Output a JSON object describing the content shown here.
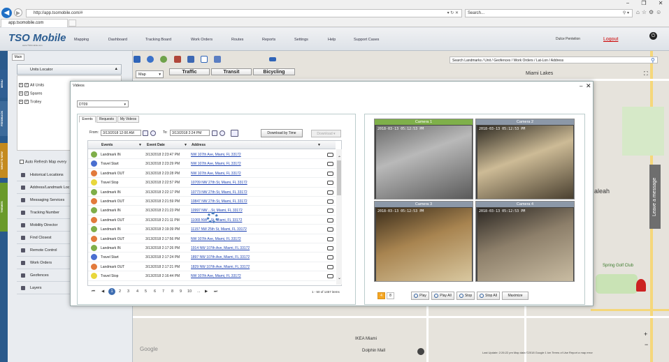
{
  "browser": {
    "url": "http://app.tsomobile.com/#",
    "search_placeholder": "Search...",
    "tab_title": "app.tsomobile.com",
    "window_controls": [
      "−",
      "❐",
      "✕"
    ]
  },
  "header": {
    "logo": "TSO Mobile",
    "logo_sub": "www.TSOmobile.com",
    "nav": [
      "Mapping",
      "Dashboard",
      "Tracking Board",
      "Work Orders",
      "Routes",
      "Reports",
      "Settings",
      "Help",
      "Support Cases"
    ],
    "user": "Dulce Pentelion",
    "logout": "Logout"
  },
  "sidebar": {
    "main_tab": "Main",
    "units_locator": "Units Locator",
    "tree": [
      "All Units",
      "Spares",
      "Trolley"
    ],
    "auto_refresh": "Auto Refresh Map every",
    "menu": [
      "Historical Locations",
      "Address/Landmark Loc",
      "Messaging Services",
      "Tracking Number",
      "Mobility Director",
      "Find Closest",
      "Remote Control",
      "Work Orders",
      "Geofences",
      "Layers"
    ],
    "vertical_tabs": [
      "MENU",
      "FEEDBACK",
      "WHAT'S NEW",
      "THEMES"
    ]
  },
  "map": {
    "select": "Map",
    "buttons": [
      "Traffic",
      "Transit",
      "Bicycling"
    ],
    "search_placeholder": "Search Landmarks / Unit / Geofences / Work Orders / Lat-Lon / Address",
    "labels": [
      "Miami Lakes",
      "aleah",
      "Spring Golf Club",
      "IKEA Miami",
      "Dolphin Mall",
      "Google"
    ],
    "leave_message": "Leave a message",
    "footer": "Last Update: 2:26:22 pm    Map data ©2018 Google    1 km    Terms of Use    Report a map error"
  },
  "dialog": {
    "title": "Videos",
    "unit": "DT09",
    "tabs": [
      "Events",
      "Requests",
      "My Videos"
    ],
    "from_label": "From:",
    "from_value": "3/13/2018 12:00 AM",
    "to_label": "To:",
    "to_value": "3/13/2018 2:24 PM",
    "download_by_time": "Download by Time",
    "download": "Download",
    "columns": [
      "Events",
      "Event Date",
      "Address"
    ],
    "rows": [
      {
        "event": "Landmark IN",
        "date": "3/13/2018 2:23:47 PM",
        "address": "NW 107th Ave, Miami, FL 33172",
        "color": "#7fae49"
      },
      {
        "event": "Travel Start",
        "date": "3/13/2018 2:23:29 PM",
        "address": "NW 107th Ave, Miami, FL 33172",
        "color": "#4a6fd0"
      },
      {
        "event": "Landmark OUT",
        "date": "3/13/2018 2:23:28 PM",
        "address": "NW 107th Ave, Miami, FL 33172",
        "color": "#e27a3c"
      },
      {
        "event": "Travel Stop",
        "date": "3/13/2018 2:22:57 PM",
        "address": "10709 NW 27th St, Miami, FL 33172",
        "color": "#e8d73b"
      },
      {
        "event": "Landmark IN",
        "date": "3/13/2018 2:22:17 PM",
        "address": "10773 NW 27th St, Miami, FL 33172",
        "color": "#7fae49"
      },
      {
        "event": "Landmark OUT",
        "date": "3/13/2018 2:21:59 PM",
        "address": "10847 NW 27th St, Miami, FL 33172",
        "color": "#e27a3c"
      },
      {
        "event": "Landmark IN",
        "date": "3/13/2018 2:21:23 PM",
        "address": "10997 NW ...St, Miami, FL 33172",
        "color": "#7fae49"
      },
      {
        "event": "Landmark OUT",
        "date": "3/13/2018 2:21:11 PM",
        "address": "11065 NW ...St, Miami, FL 33172",
        "color": "#e27a3c"
      },
      {
        "event": "Landmark IN",
        "date": "3/13/2018 2:19:39 PM",
        "address": "11157 NW 25th St, Miami, FL 33172",
        "color": "#7fae49"
      },
      {
        "event": "Landmark OUT",
        "date": "3/13/2018 2:17:56 PM",
        "address": "NW 107th Ave, Miami, FL 33172",
        "color": "#e27a3c"
      },
      {
        "event": "Landmark IN",
        "date": "3/13/2018 2:17:26 PM",
        "address": "1914 NW 107th Ave, Miami, FL 33172",
        "color": "#7fae49"
      },
      {
        "event": "Travel Start",
        "date": "3/13/2018 2:17:24 PM",
        "address": "1897 NW 107th Ave, Miami, FL 33172",
        "color": "#4a6fd0"
      },
      {
        "event": "Landmark OUT",
        "date": "3/13/2018 2:17:21 PM",
        "address": "1829 NW 107th Ave, Miami, FL 33172",
        "color": "#e27a3c"
      },
      {
        "event": "Travel Stop",
        "date": "3/13/2018 2:16:44 PM",
        "address": "NW 107th Ave, Miami, FL 33172",
        "color": "#e8d73b"
      }
    ],
    "pager": [
      "1",
      "2",
      "3",
      "4",
      "5",
      "6",
      "7",
      "8",
      "9",
      "10",
      "..."
    ],
    "pager_info": "1 - 50 of 1457 items",
    "cameras": [
      {
        "label": "Camera 1",
        "timestamp": "2018-03-13 05:12:53 PM",
        "header_color": "#7fb04a"
      },
      {
        "label": "Camera 2",
        "timestamp": "2018-03-13 05:12:53 PM",
        "header_color": "#8c98a8"
      },
      {
        "label": "Camera 3",
        "timestamp": "2018-03-13 05:12:53 PM",
        "header_color": "#8c98a8"
      },
      {
        "label": "Camera 4",
        "timestamp": "2018-03-13 05:12:53 PM",
        "header_color": "#8c98a8"
      }
    ],
    "layout_buttons": [
      "4",
      "8"
    ],
    "controls": [
      "Play",
      "Play All",
      "Stop",
      "Stop All",
      "Maximize"
    ]
  }
}
